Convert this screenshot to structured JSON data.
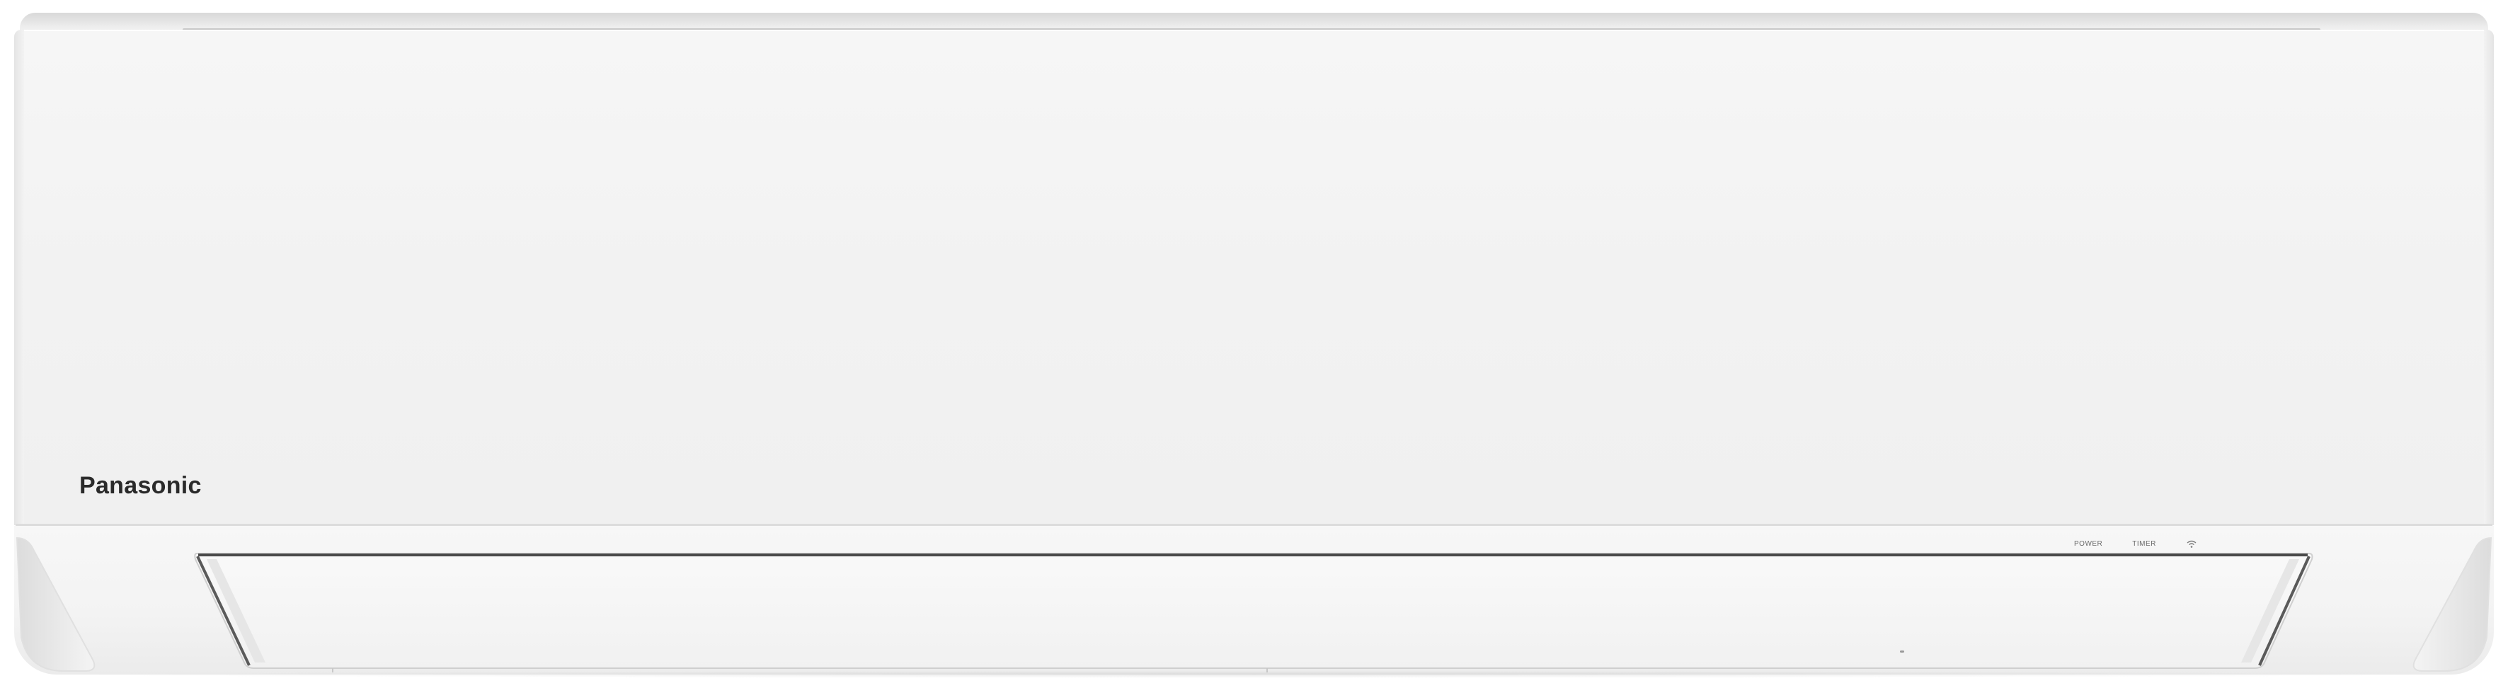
{
  "product": {
    "brand": "Panasonic",
    "indicators": {
      "power_label": "POWER",
      "timer_label": "TIMER",
      "wifi_icon": "wifi-icon"
    }
  },
  "colors": {
    "body": "#f2f2f2",
    "top_strip": "#d8d8d8",
    "logo_text": "#2a2a2a",
    "louver_edge": "#4a4a4a"
  }
}
